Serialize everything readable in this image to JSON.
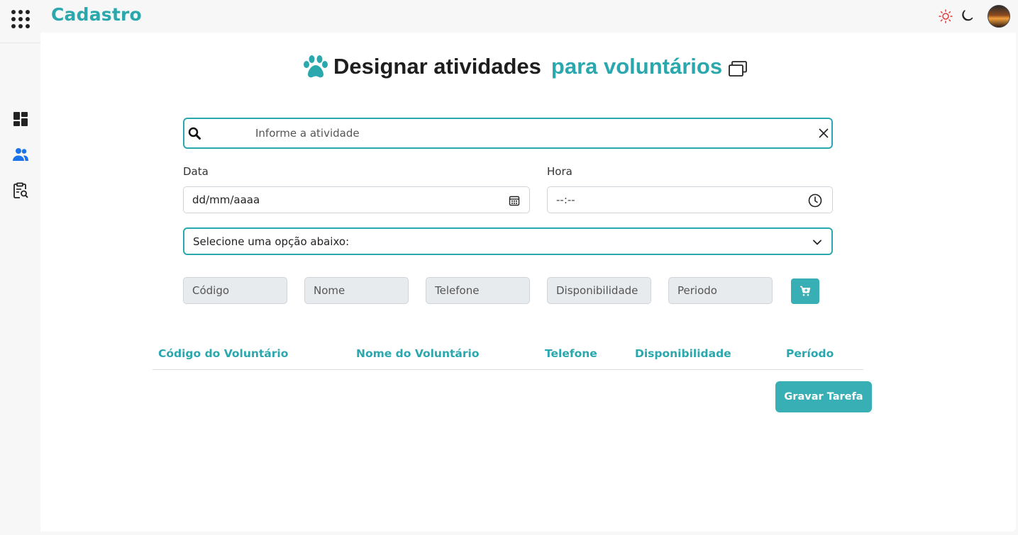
{
  "header": {
    "brand": "Cadastro",
    "icons": [
      "apps-grid-icon",
      "sun-icon",
      "moon-icon",
      "avatar"
    ]
  },
  "sidebar": {
    "items": [
      {
        "icon": "dashboard-icon"
      },
      {
        "icon": "users-icon",
        "active": true
      },
      {
        "icon": "clipboard-search-icon"
      }
    ]
  },
  "page": {
    "title_main": "Designar atividades",
    "title_accent": "para voluntários",
    "title_icon": "paw-icon",
    "title_trailing_icon": "copy-icon"
  },
  "search": {
    "placeholder": "Informe a atividade",
    "value": ""
  },
  "form": {
    "date_label": "Data",
    "date_value": "dd/mm/aaaa",
    "time_label": "Hora",
    "time_value": "--:--",
    "select_text": "Selecione uma opção abaixo:"
  },
  "readonly_fields": {
    "codigo": "Código",
    "nome": "Nome",
    "telefone": "Telefone",
    "disponibilidade": "Disponibilidade",
    "periodo": "Periodo"
  },
  "table": {
    "headers": [
      "Código do Voluntário",
      "Nome do Voluntário",
      "Telefone",
      "Disponibilidade",
      "Período"
    ],
    "rows": []
  },
  "actions": {
    "save_label": "Gravar Tarefa"
  },
  "colors": {
    "accent": "#2aa8ad",
    "button": "#37afb4",
    "active_sidebar": "#1a73e8"
  }
}
